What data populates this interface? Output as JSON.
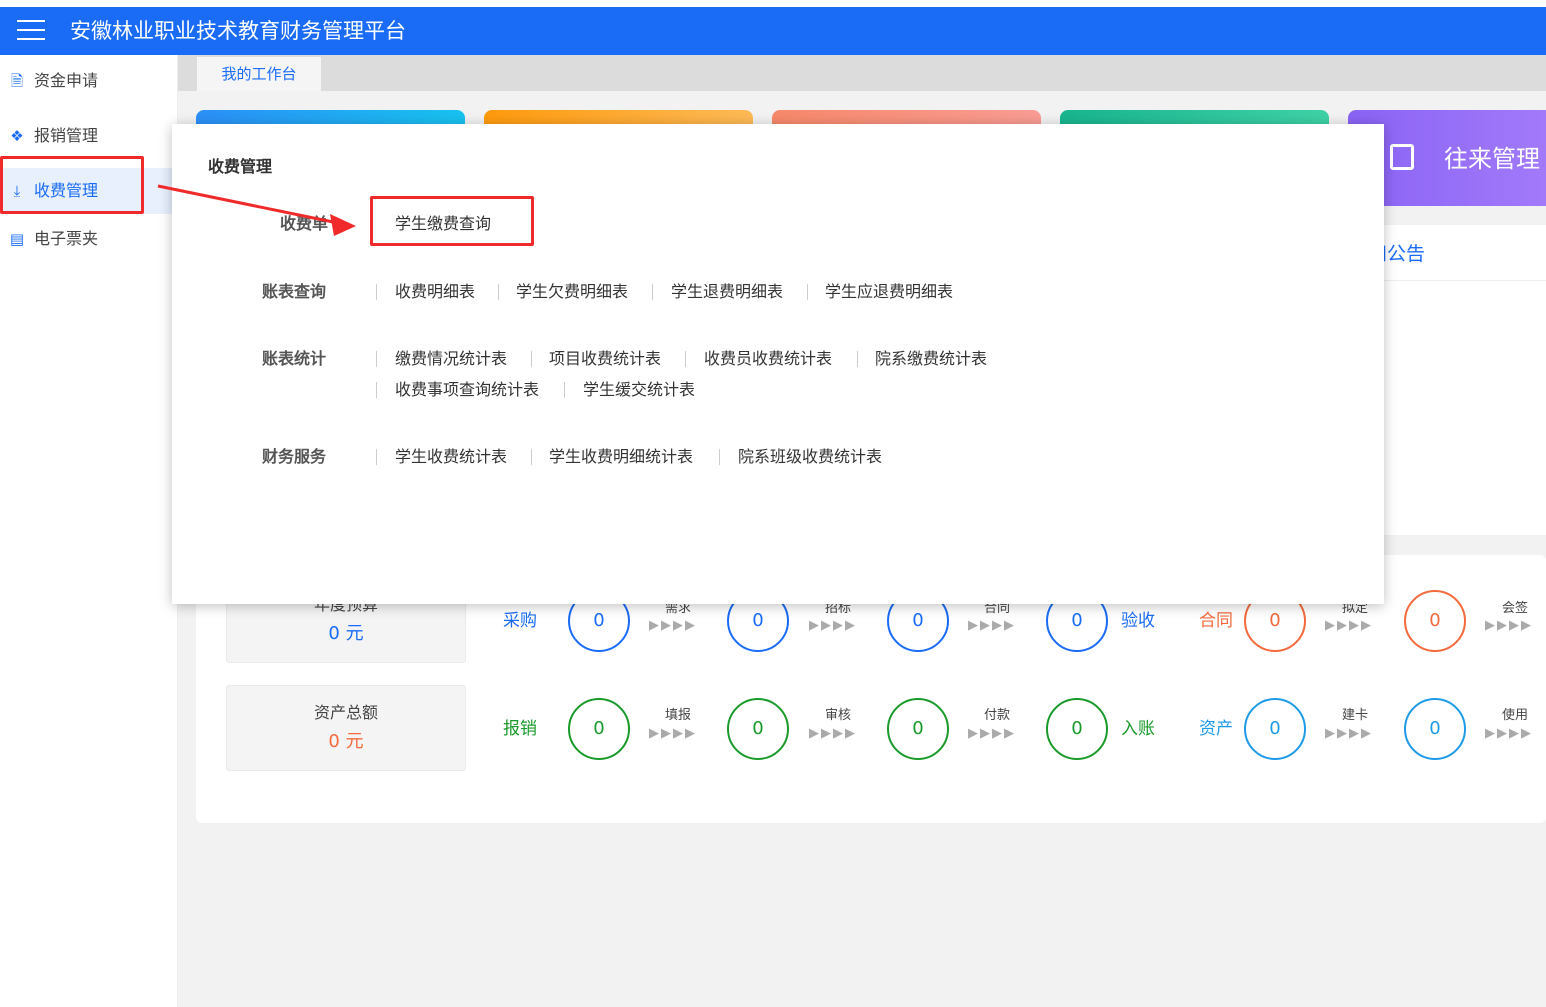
{
  "header": {
    "title": "安徽林业职业技术教育财务管理平台"
  },
  "sidebar": {
    "items": [
      {
        "label": "资金申请",
        "icon": "document-icon"
      },
      {
        "label": "报销管理",
        "icon": "layers-icon"
      },
      {
        "label": "收费管理",
        "icon": "download-icon"
      },
      {
        "label": "电子票夹",
        "icon": "ticket-icon"
      }
    ]
  },
  "tabs": {
    "active": "我的工作台"
  },
  "tiles": {
    "visible_label": "往来管理"
  },
  "notice": {
    "title": "通知公告",
    "visible_text": "知公告"
  },
  "stats": {
    "budget_label": "年度预算",
    "budget_value": "0 元",
    "asset_label": "资产总额",
    "asset_value": "0 元",
    "row1": {
      "purchase_label": "采购",
      "purchase_steps": [
        "需求",
        "招标",
        "合同"
      ],
      "purchase_end": "验收",
      "contract_label": "合同",
      "contract_steps": [
        "拟定",
        "会签"
      ],
      "counts": [
        "0",
        "0",
        "0",
        "0",
        "0",
        "0"
      ]
    },
    "row2": {
      "reimb_label": "报销",
      "reimb_steps": [
        "填报",
        "审核",
        "付款"
      ],
      "reimb_end": "入账",
      "asset_label": "资产",
      "asset_steps": [
        "建卡",
        "使用"
      ],
      "counts": [
        "0",
        "0",
        "0",
        "0",
        "0",
        "0"
      ]
    },
    "arrows": "▶▶▶▶"
  },
  "mega_menu": {
    "title": "收费管理",
    "groups": [
      {
        "label": "收费单",
        "items": [
          "学生缴费查询"
        ]
      },
      {
        "label": "账表查询",
        "items": [
          "收费明细表",
          "学生欠费明细表",
          "学生退费明细表",
          "学生应退费明细表"
        ]
      },
      {
        "label": "账表统计",
        "items": [
          "缴费情况统计表",
          "项目收费统计表",
          "收费员收费统计表",
          "院系缴费统计表",
          "收费事项查询统计表",
          "学生缓交统计表"
        ]
      },
      {
        "label": "财务服务",
        "items": [
          "学生收费统计表",
          "学生收费明细统计表",
          "院系班级收费统计表"
        ]
      }
    ]
  },
  "colors": {
    "primary": "#1a6cf6",
    "green": "#1a9a2a",
    "orange": "#f36a3c",
    "cyan": "#1e9be8",
    "highlight": "#f02a2a"
  }
}
